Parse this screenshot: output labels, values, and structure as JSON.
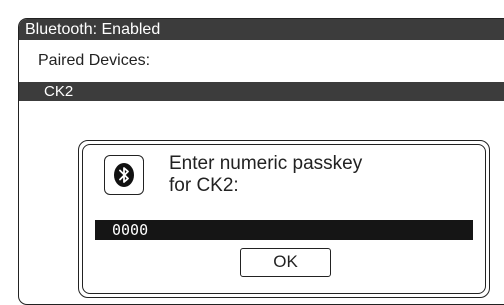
{
  "titlebar": {
    "title": "Bluetooth: Enabled"
  },
  "paired": {
    "label": "Paired Devices:",
    "devices": [
      {
        "name": "CK2"
      }
    ]
  },
  "dialog": {
    "icon": "bluetooth-icon",
    "message": "Enter numeric passkey\nfor CK2:",
    "passkey_value": "0000",
    "ok_label": "OK"
  }
}
